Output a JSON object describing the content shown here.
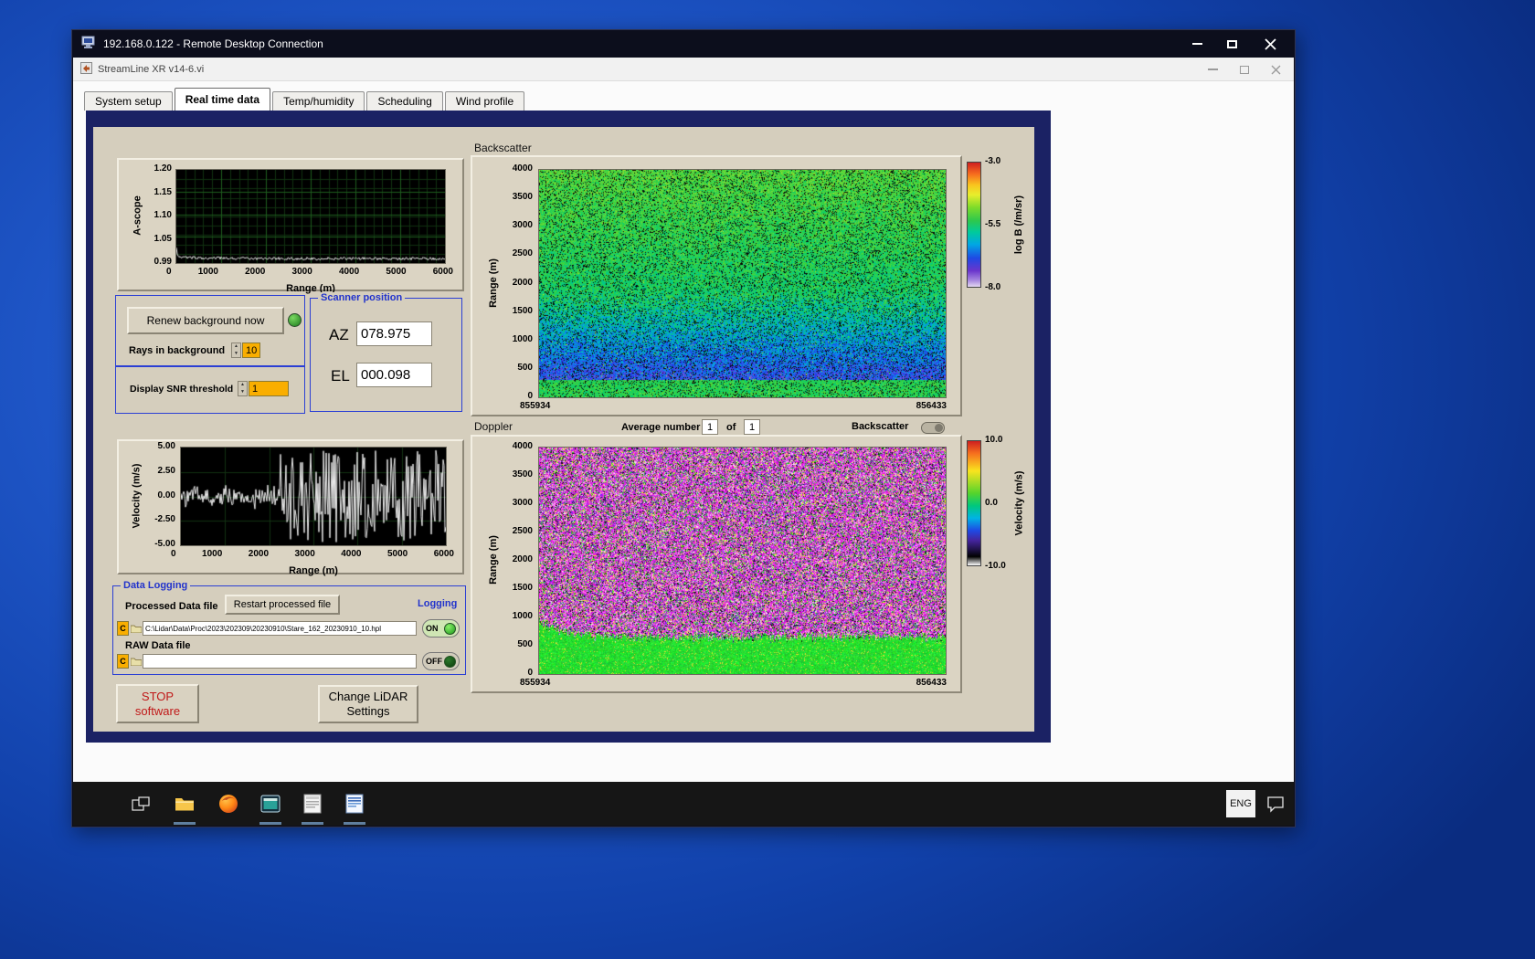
{
  "rdp": {
    "title": "192.168.0.122 - Remote Desktop Connection"
  },
  "app": {
    "title": "StreamLine XR v14-6.vi",
    "tabs": [
      "System setup",
      "Real time data",
      "Temp/humidity",
      "Scheduling",
      "Wind profile"
    ]
  },
  "ascope": {
    "y_label": "A-scope",
    "x_label": "Range (m)",
    "y_ticks": [
      "1.20",
      "1.15",
      "1.10",
      "1.05",
      "0.99"
    ],
    "x_ticks": [
      "0",
      "1000",
      "2000",
      "3000",
      "4000",
      "5000",
      "6000"
    ]
  },
  "background_controls": {
    "renew_button": "Renew background now",
    "rays_label": "Rays in background",
    "rays_value": "10",
    "snr_label": "Display SNR threshold",
    "snr_value": "1"
  },
  "scanner": {
    "title": "Scanner position",
    "az_label": "AZ",
    "az_value": "078.975",
    "el_label": "EL",
    "el_value": "000.098"
  },
  "backscatter": {
    "title": "Backscatter",
    "y_label": "Range (m)",
    "y_ticks": [
      "4000",
      "3500",
      "3000",
      "2500",
      "2000",
      "1500",
      "1000",
      "500",
      "0"
    ],
    "x_left": "855934",
    "x_right": "856433",
    "cb_ticks": [
      "-3.0",
      "-5.5",
      "-8.0"
    ],
    "cb_label": "log B (/m/sr)"
  },
  "doppler": {
    "title": "Doppler",
    "avg_label": "Average number",
    "avg_value": "1",
    "of_label": "of",
    "of_value": "1",
    "toggle_label": "Backscatter",
    "y_label": "Range (m)",
    "y_ticks": [
      "4000",
      "3500",
      "3000",
      "2500",
      "2000",
      "1500",
      "1000",
      "500",
      "0"
    ],
    "x_left": "855934",
    "x_right": "856433",
    "cb_ticks": [
      "10.0",
      "0.0",
      "-10.0"
    ],
    "cb_label": "Velocity (m/s)"
  },
  "velocity": {
    "y_label": "Velocity (m/s)",
    "x_label": "Range (m)",
    "y_ticks": [
      "5.00",
      "2.50",
      "0.00",
      "-2.50",
      "-5.00"
    ],
    "x_ticks": [
      "0",
      "1000",
      "2000",
      "3000",
      "4000",
      "5000",
      "6000"
    ]
  },
  "logging": {
    "title": "Data Logging",
    "processed_label": "Processed Data file",
    "restart_button": "Restart processed file",
    "logging_label": "Logging",
    "drive": "C",
    "processed_path": "C:\\Lidar\\Data\\Proc\\2023\\202309\\20230910\\Stare_162_20230910_10.hpl",
    "on_label": "ON",
    "raw_label": "RAW Data file",
    "raw_path": "",
    "off_label": "OFF"
  },
  "actions": {
    "stop_line1": "STOP",
    "stop_line2": "software",
    "change_line1": "Change LiDAR",
    "change_line2": "Settings"
  },
  "taskbar": {
    "language": "ENG"
  }
}
